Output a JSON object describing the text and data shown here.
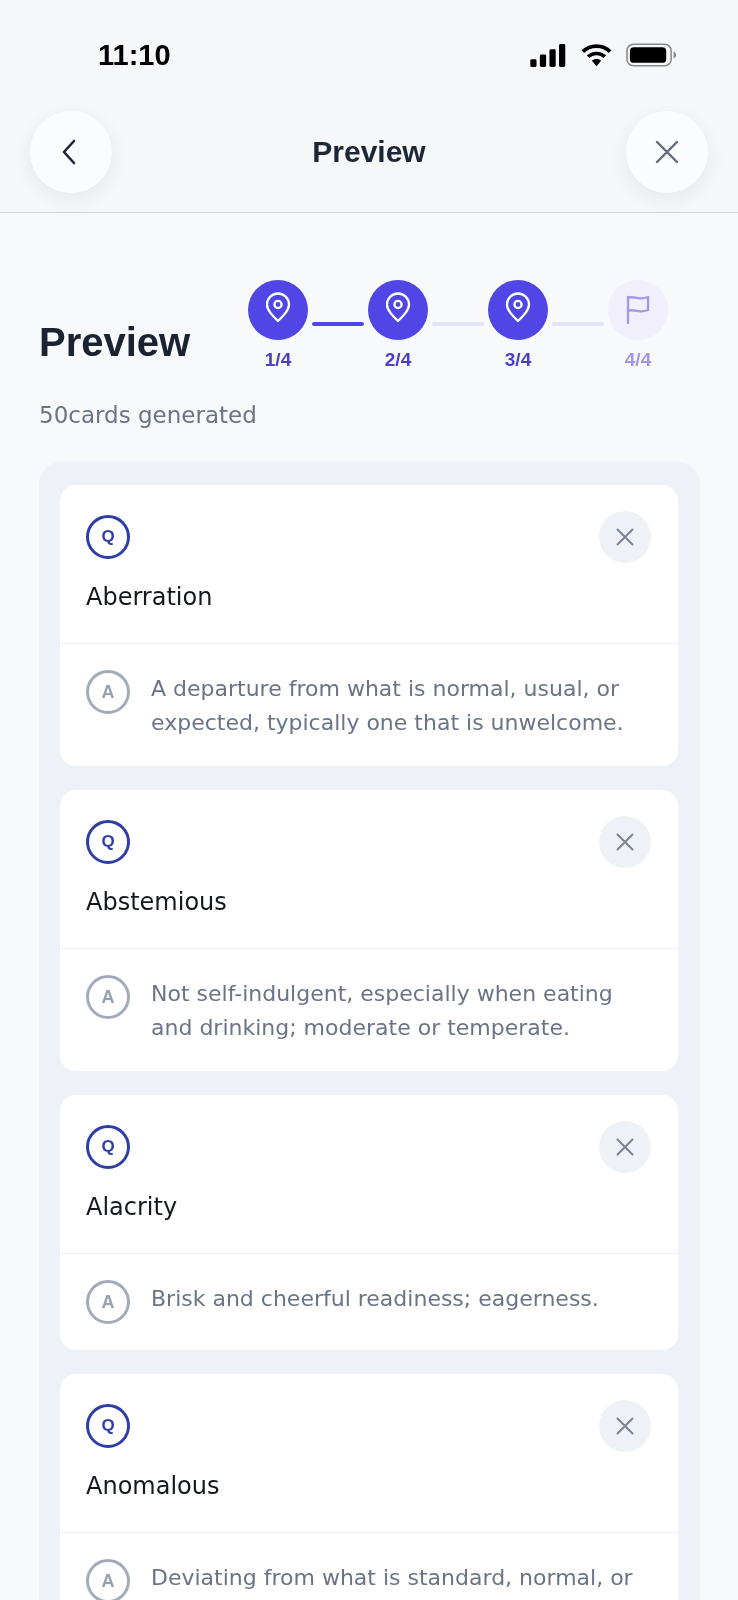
{
  "status_bar": {
    "time": "11:10"
  },
  "header": {
    "title": "Preview"
  },
  "page": {
    "title": "Preview",
    "subtitle": "50cards generated"
  },
  "stepper": {
    "steps": [
      {
        "label": "1/4",
        "kind": "checkpoint",
        "completed": true
      },
      {
        "label": "2/4",
        "kind": "checkpoint",
        "completed": true
      },
      {
        "label": "3/4",
        "kind": "checkpoint",
        "completed": true
      },
      {
        "label": "4/4",
        "kind": "finish",
        "completed": false
      }
    ],
    "connectors": [
      {
        "filled": true
      },
      {
        "filled": false
      },
      {
        "filled": false
      }
    ]
  },
  "cards": [
    {
      "question_badge": "Q",
      "term": "Aberration",
      "answer_badge": "A",
      "definition": "A departure from what is normal, usual, or expected, typically one that is unwelcome."
    },
    {
      "question_badge": "Q",
      "term": "Abstemious",
      "answer_badge": "A",
      "definition": "Not self-indulgent, especially when eating and drinking; moderate or temperate."
    },
    {
      "question_badge": "Q",
      "term": "Alacrity",
      "answer_badge": "A",
      "definition": "Brisk and cheerful readiness; eagerness."
    },
    {
      "question_badge": "Q",
      "term": "Anomalous",
      "answer_badge": "A",
      "definition": "Deviating from what is standard, normal, or"
    }
  ]
}
